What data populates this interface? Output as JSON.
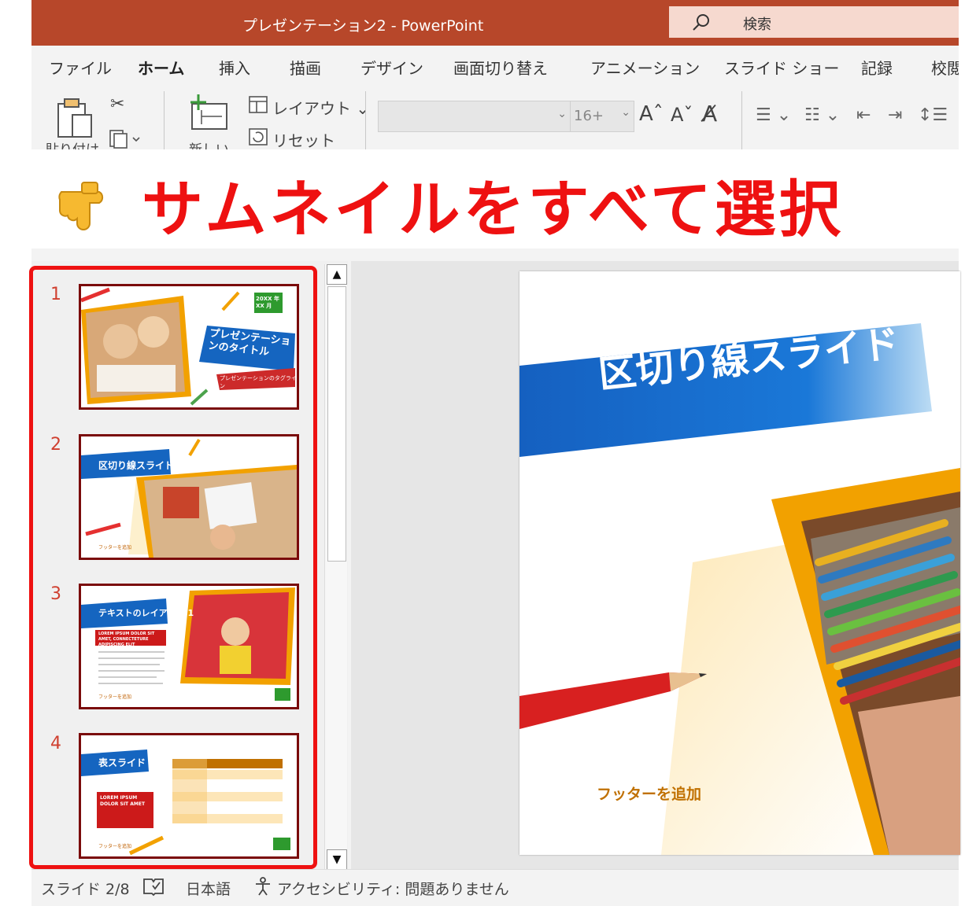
{
  "window": {
    "title": "プレゼンテーション2  -  PowerPoint"
  },
  "search": {
    "label": "検索"
  },
  "tabs": [
    "ファイル",
    "ホーム",
    "挿入",
    "描画",
    "デザイン",
    "画面切り替え",
    "アニメーション",
    "スライド ショー",
    "記録",
    "校閲"
  ],
  "ribbon": {
    "paste_label": "貼り付け",
    "new_slide_label": "新しい",
    "layout_label": "レイアウト ⌄",
    "reset_label": "リセット",
    "font_size": "16+"
  },
  "banner": {
    "text": "サムネイルをすべて選択"
  },
  "thumbnails": [
    {
      "number": "1",
      "title": "プレゼンテーションのタイトル",
      "subtitle": "プレゼンテーションのタグライン",
      "date": "20XX 年 XX 月"
    },
    {
      "number": "2",
      "title": "区切り線スライド",
      "footer": "フッターを追加"
    },
    {
      "number": "3",
      "title": "テキストのレイアウト 1",
      "box": "LOREM IPSUM DOLOR SIT AMET, CONNECTETURE ADIPISCING ELIT",
      "footer": "フッターを追加"
    },
    {
      "number": "4",
      "title": "表スライド",
      "box": "LOREM IPSUM DOLOR SIT AMET",
      "footer": "フッターを追加"
    }
  ],
  "main_slide": {
    "title": "区切り線スライド",
    "footer": "フッターを追加"
  },
  "status": {
    "slide": "スライド 2/8",
    "language": "日本語",
    "accessibility": "アクセシビリティ: 問題ありません"
  },
  "colors": {
    "accent": "#b7472a",
    "banner_text": "#ee1111",
    "selection": "#ee1111",
    "thumb_border": "#7a0b0b",
    "slide_blue": "#1565c0",
    "slide_orange": "#f2a100"
  },
  "icons": [
    "search-icon",
    "cut-icon",
    "copy-icon",
    "paste-icon",
    "new-slide-icon",
    "layout-icon",
    "reset-icon",
    "grow-font-icon",
    "shrink-font-icon",
    "clear-format-icon",
    "bullets-icon",
    "numbering-icon",
    "outdent-icon",
    "indent-icon",
    "line-spacing-icon",
    "pointing-hand-icon",
    "notes-icon",
    "accessibility-icon"
  ]
}
